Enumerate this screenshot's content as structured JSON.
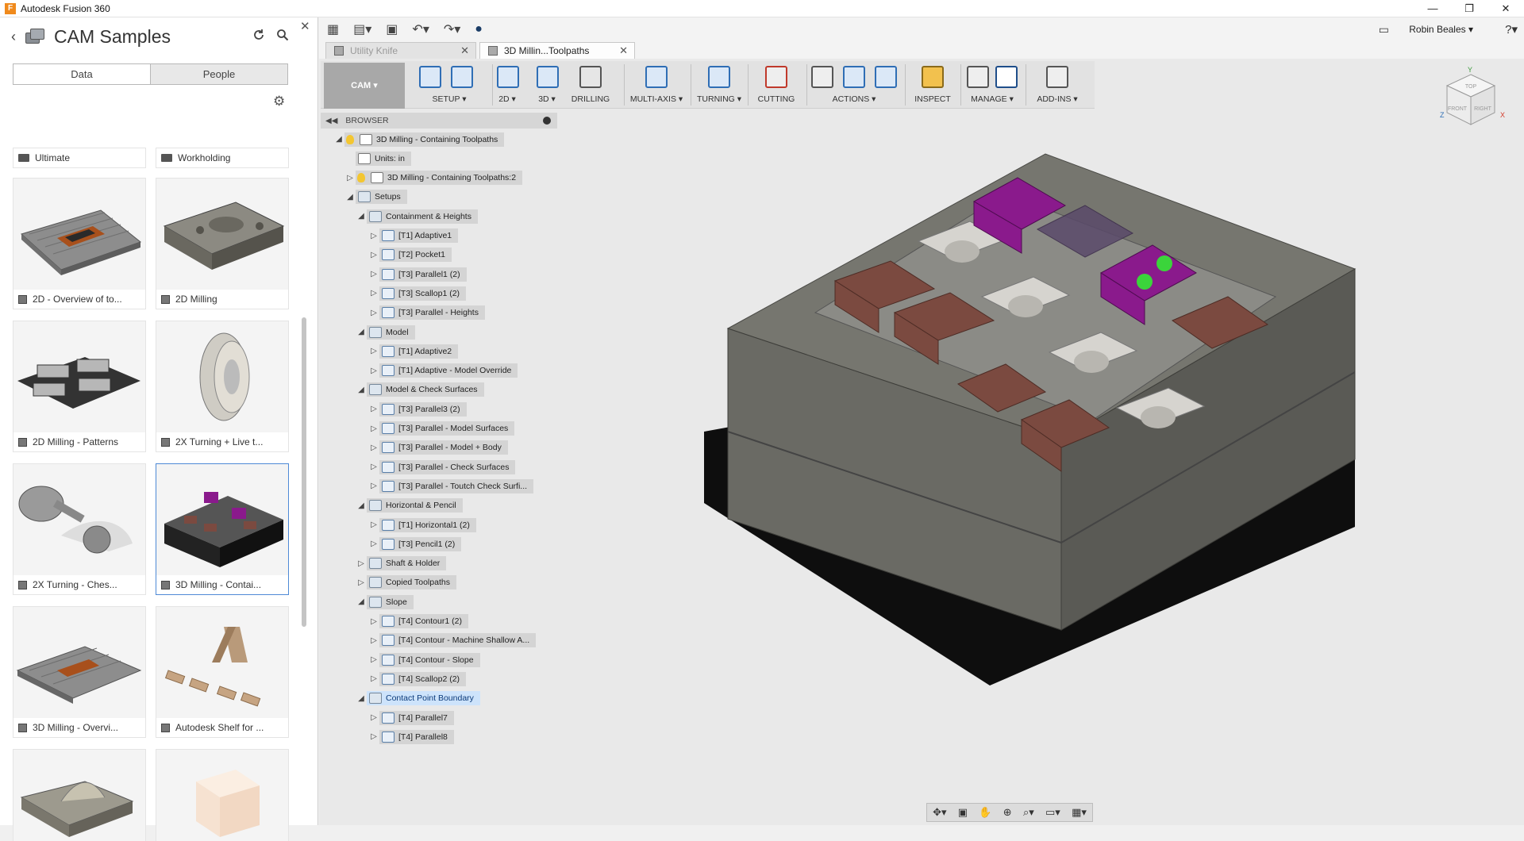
{
  "window": {
    "title": "Autodesk Fusion 360",
    "app_icon": "F",
    "minimize": "—",
    "restore": "❐",
    "close": "✕"
  },
  "data_panel": {
    "back": "‹",
    "project_title": "CAM Samples",
    "tabs": [
      "Data",
      "People"
    ],
    "folders": [
      "Ultimate",
      "Workholding"
    ],
    "items": [
      {
        "label": "2D - Overview of to..."
      },
      {
        "label": "2D Milling"
      },
      {
        "label": "2D Milling - Patterns"
      },
      {
        "label": "2X Turning + Live t..."
      },
      {
        "label": "2X Turning - Ches..."
      },
      {
        "label": "3D Milling - Contai..."
      },
      {
        "label": "3D Milling - Overvi..."
      },
      {
        "label": "Autodesk Shelf for ..."
      },
      {
        "label": ""
      },
      {
        "label": ""
      }
    ]
  },
  "toolbar": {
    "user": "Robin Beales ▾",
    "help": "?▾"
  },
  "doc_tabs": [
    {
      "label": "Utility Knife"
    },
    {
      "label": "3D Millin...Toolpaths"
    }
  ],
  "ribbon": {
    "workspace": "CAM ▾",
    "groups": [
      "SETUP ▾",
      "2D ▾",
      "3D ▾",
      "DRILLING",
      "MULTI-AXIS ▾",
      "TURNING ▾",
      "CUTTING",
      "ACTIONS ▾",
      "INSPECT",
      "MANAGE ▾",
      "ADD-INS ▾"
    ]
  },
  "browser": {
    "title": "BROWSER",
    "nodes": [
      {
        "label": "3D Milling - Containing  Toolpaths",
        "level": 0,
        "tri": "◢",
        "type": "root"
      },
      {
        "label": "Units: in",
        "level": 1,
        "tri": "",
        "type": "doc"
      },
      {
        "label": "3D Milling - Containing  Toolpaths:2",
        "level": 1,
        "tri": "▷",
        "type": "root"
      },
      {
        "label": "Setups",
        "level": 1,
        "tri": "◢",
        "type": "folder"
      },
      {
        "label": "Containment & Heights",
        "level": 2,
        "tri": "◢",
        "type": "folder"
      },
      {
        "label": "[T1] Adaptive1",
        "level": 3,
        "tri": "▷",
        "type": "op"
      },
      {
        "label": "[T2] Pocket1",
        "level": 3,
        "tri": "▷",
        "type": "op"
      },
      {
        "label": "[T3] Parallel1 (2)",
        "level": 3,
        "tri": "▷",
        "type": "op"
      },
      {
        "label": "[T3] Scallop1 (2)",
        "level": 3,
        "tri": "▷",
        "type": "op"
      },
      {
        "label": "[T3] Parallel - Heights",
        "level": 3,
        "tri": "▷",
        "type": "op"
      },
      {
        "label": "Model",
        "level": 2,
        "tri": "◢",
        "type": "folder"
      },
      {
        "label": "[T1] Adaptive2",
        "level": 3,
        "tri": "▷",
        "type": "op"
      },
      {
        "label": "[T1] Adaptive - Model Override",
        "level": 3,
        "tri": "▷",
        "type": "op"
      },
      {
        "label": "Model & Check Surfaces",
        "level": 2,
        "tri": "◢",
        "type": "folder"
      },
      {
        "label": "[T3] Parallel3 (2)",
        "level": 3,
        "tri": "▷",
        "type": "op"
      },
      {
        "label": "[T3] Parallel - Model Surfaces",
        "level": 3,
        "tri": "▷",
        "type": "op"
      },
      {
        "label": "[T3] Parallel - Model + Body",
        "level": 3,
        "tri": "▷",
        "type": "op"
      },
      {
        "label": "[T3] Parallel - Check Surfaces",
        "level": 3,
        "tri": "▷",
        "type": "op"
      },
      {
        "label": "[T3] Parallel - Toutch Check Surfi...",
        "level": 3,
        "tri": "▷",
        "type": "op"
      },
      {
        "label": "Horizontal & Pencil",
        "level": 2,
        "tri": "◢",
        "type": "folder"
      },
      {
        "label": "[T1] Horizontal1 (2)",
        "level": 3,
        "tri": "▷",
        "type": "op"
      },
      {
        "label": "[T3] Pencil1 (2)",
        "level": 3,
        "tri": "▷",
        "type": "op"
      },
      {
        "label": "Shaft & Holder",
        "level": 2,
        "tri": "▷",
        "type": "folder"
      },
      {
        "label": "Copied Toolpaths",
        "level": 2,
        "tri": "▷",
        "type": "folder"
      },
      {
        "label": "Slope",
        "level": 2,
        "tri": "◢",
        "type": "folder"
      },
      {
        "label": "[T4] Contour1 (2)",
        "level": 3,
        "tri": "▷",
        "type": "op"
      },
      {
        "label": "[T4] Contour - Machine Shallow A...",
        "level": 3,
        "tri": "▷",
        "type": "op"
      },
      {
        "label": "[T4] Contour - Slope",
        "level": 3,
        "tri": "▷",
        "type": "op"
      },
      {
        "label": "[T4] Scallop2 (2)",
        "level": 3,
        "tri": "▷",
        "type": "op"
      },
      {
        "label": "Contact Point Boundary",
        "level": 2,
        "tri": "◢",
        "type": "folder",
        "highlight": true
      },
      {
        "label": "[T4] Parallel7",
        "level": 3,
        "tri": "▷",
        "type": "op"
      },
      {
        "label": "[T4] Parallel8",
        "level": 3,
        "tri": "▷",
        "type": "op"
      }
    ]
  },
  "viewcube": {
    "top": "TOP",
    "front": "FRONT",
    "right": "RIGHT",
    "x": "X",
    "y": "Y",
    "z": "Z"
  },
  "colors": {
    "accent": "#2f6eb5",
    "selection": "#cde3fb",
    "part_purple": "#8a1a8c",
    "stock_gray": "#6e6e68",
    "fixture_brown": "#7b4a40"
  }
}
